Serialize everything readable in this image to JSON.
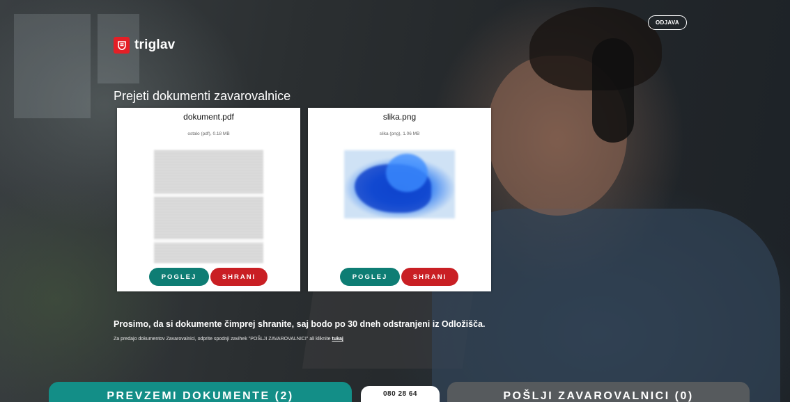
{
  "header": {
    "brand": "triglav",
    "logout_label": "ODJAVA"
  },
  "section": {
    "title": "Prejeti dokumenti zavarovalnice"
  },
  "documents": [
    {
      "name": "dokument.pdf",
      "meta": "ostalo (pdf), 0.18 MB",
      "view_label": "POGLEJ",
      "save_label": "SHRANI"
    },
    {
      "name": "slika.png",
      "meta": "slika (png), 1.06 MB",
      "view_label": "POGLEJ",
      "save_label": "SHRANI"
    }
  ],
  "notice": {
    "main": "Prosimo, da si dokumente čimprej shranite, saj bodo po 30 dneh odstranjeni iz Odložišča.",
    "sub": "Za predajo dokumentov Zavarovalnici, odprite spodnji zavihek \"POŠLJI ZAVAROVALNICI\" ali kliknite",
    "link": "tukaj"
  },
  "footer": {
    "download_tab": "PREVZEMI DOKUMENTE (2)",
    "phone": "080 28 64",
    "send_tab": "POŠLJI ZAVAROVALNICI (0)"
  },
  "colors": {
    "brand_red": "#e41f26",
    "teal": "#0e7d74",
    "save_red": "#c91f24",
    "send_tab_gray": "#565a5d"
  }
}
